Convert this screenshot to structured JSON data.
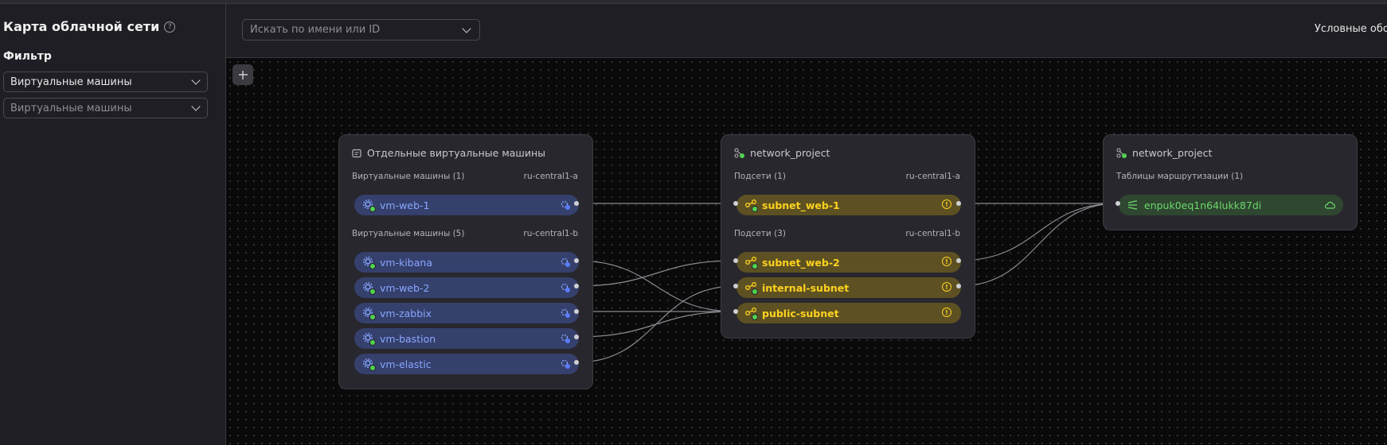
{
  "sidebar": {
    "title": "Карта облачной сети",
    "filter_label": "Фильтр",
    "filter_type": "Виртуальные машины",
    "filter_value_placeholder": "Виртуальные машины"
  },
  "topbar": {
    "search_placeholder": "Искать по имени или ID",
    "legend_label": "Условные обоз"
  },
  "panels": {
    "vms": {
      "title": "Отдельные виртуальные машины",
      "groups": [
        {
          "label": "Виртуальные машины (1)",
          "zone": "ru-central1-a",
          "items": [
            "vm-web-1"
          ]
        },
        {
          "label": "Виртуальные машины (5)",
          "zone": "ru-central1-b",
          "items": [
            "vm-kibana",
            "vm-web-2",
            "vm-zabbix",
            "vm-bastion",
            "vm-elastic"
          ]
        }
      ]
    },
    "network": {
      "title": "network_project",
      "groups": [
        {
          "label": "Подсети (1)",
          "zone": "ru-central1-a",
          "items": [
            "subnet_web-1"
          ]
        },
        {
          "label": "Подсети (3)",
          "zone": "ru-central1-b",
          "items": [
            "subnet_web-2",
            "internal-subnet",
            "public-subnet"
          ]
        }
      ]
    },
    "routes": {
      "title": "network_project",
      "section_label": "Таблицы маршрутизации (1)",
      "items": [
        "enpuk0eq1n64lukk87di"
      ]
    }
  },
  "colors": {
    "vm_node": "#35406c",
    "subnet_node": "#5d5123",
    "route_node": "#2f4630",
    "status_ok": "#4fd34f"
  }
}
